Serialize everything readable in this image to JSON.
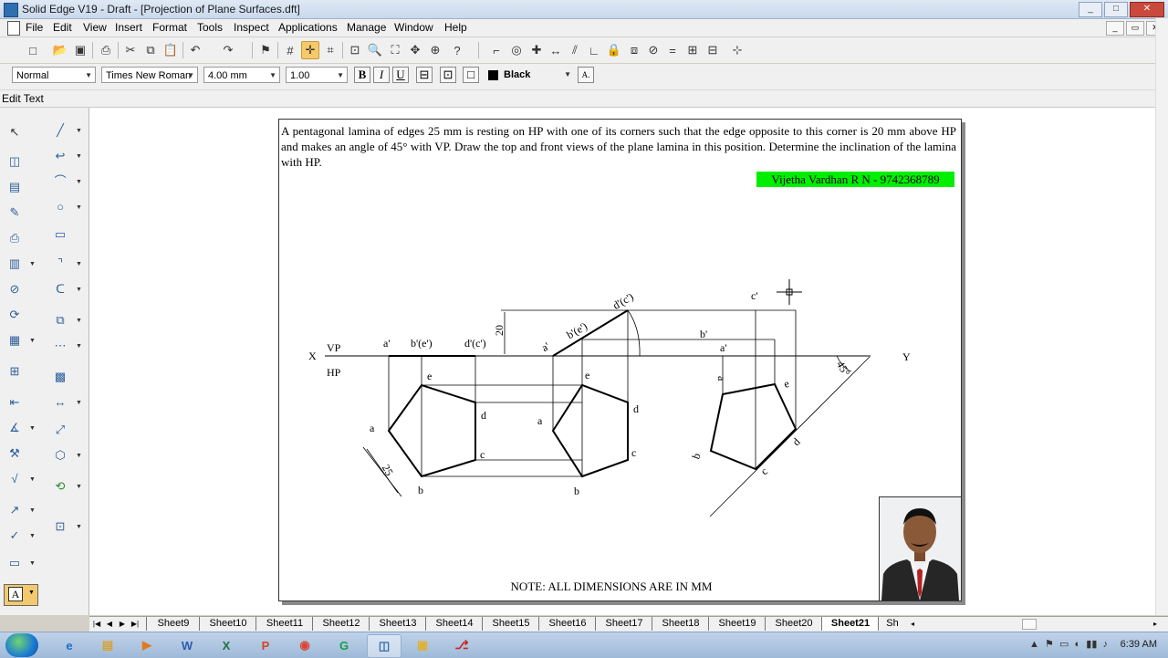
{
  "window": {
    "title": "Solid Edge V19 - Draft - [Projection of Plane Surfaces.dft]",
    "controls": {
      "minimize": "_",
      "maximize": "□",
      "close": "✕"
    }
  },
  "menu": {
    "items": [
      "File",
      "Edit",
      "View",
      "Insert",
      "Format",
      "Tools",
      "Inspect",
      "Applications",
      "Manage",
      "Window",
      "Help"
    ]
  },
  "format_bar": {
    "style": "Normal",
    "font": "Times New Roman",
    "size": "4.00 mm",
    "spacing": "1.00",
    "bold": "B",
    "italic": "I",
    "underline": "U",
    "color": "Black"
  },
  "command": {
    "label": "Edit Text"
  },
  "sheet": {
    "problem_text": "A pentagonal lamina of edges 25 mm is resting on HP with one of its corners such that the edge opposite to this corner is 20 mm above HP and makes an angle of 45° with VP. Draw the top and front views of the plane lamina in this position. Determine the inclination of the lamina with HP.",
    "author": "Vijetha Vardhan R N - 9742368789",
    "note": "NOTE: ALL DIMENSIONS ARE IN MM"
  },
  "drawing": {
    "x_label": "X",
    "y_label": "Y",
    "vp_label": "VP",
    "hp_label": "HP",
    "dim_edge": "25",
    "dim_height": "20",
    "dim_angle": "45°",
    "view1": {
      "a_front": "a'",
      "be_front": "b'(e')",
      "dc_front": "d'(c')",
      "a": "a",
      "b": "b",
      "c": "c",
      "d": "d",
      "e": "e"
    },
    "view2": {
      "a_front": "a'",
      "be_front": "b'(e')",
      "dc_front": "d'(c')",
      "a": "a",
      "b": "b",
      "c": "c",
      "d": "d",
      "e": "e"
    },
    "view3": {
      "c_front": "c'",
      "b_front": "b'",
      "a_front": "a'",
      "a": "a",
      "b": "b",
      "c": "c",
      "d": "d",
      "e": "e"
    }
  },
  "sheet_tabs": {
    "tabs": [
      "Sheet9",
      "Sheet10",
      "Sheet11",
      "Sheet12",
      "Sheet13",
      "Sheet14",
      "Sheet15",
      "Sheet16",
      "Sheet17",
      "Sheet18",
      "Sheet19",
      "Sheet20",
      "Sheet21",
      "Sh"
    ],
    "selected": "Sheet21"
  },
  "taskbar": {
    "time": "6:39 AM",
    "apps": [
      "ie",
      "explorer",
      "media",
      "W",
      "X",
      "P",
      "chrome",
      "G",
      "solid-edge",
      "files",
      "pdf"
    ]
  },
  "colors": {
    "author_highlight": "#00ee00",
    "active_tool": "#f6c96a"
  }
}
